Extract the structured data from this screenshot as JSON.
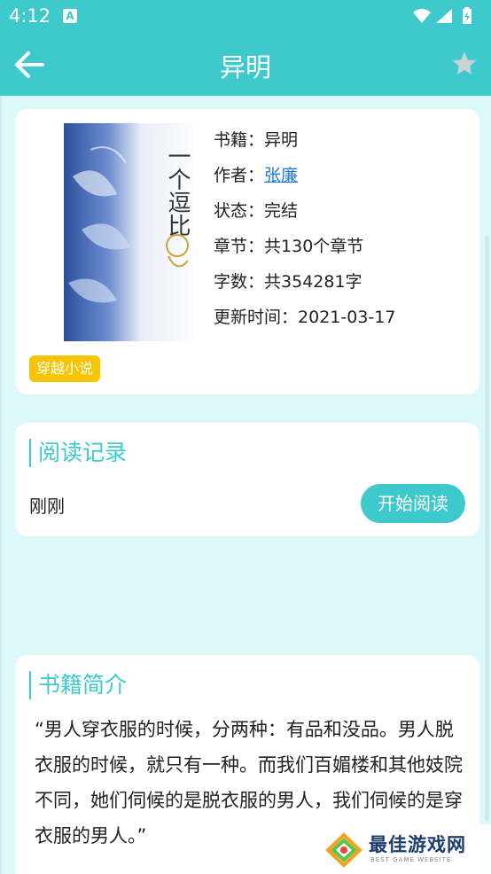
{
  "status_bar": {
    "time": "4:12",
    "notification_letter": "A"
  },
  "app_bar": {
    "title": "异明",
    "back_icon": "arrow-left-icon",
    "favorite_icon": "star-icon"
  },
  "book": {
    "cover_title": "一个逗比",
    "rows": {
      "name": {
        "label": "书籍：",
        "value": "异明"
      },
      "author": {
        "label": "作者：",
        "value": "张廉"
      },
      "status": {
        "label": "状态：",
        "value": "完结"
      },
      "chapters": {
        "label": "章节：",
        "value": "共130个章节"
      },
      "words": {
        "label": "字数：",
        "value": "共354281字"
      },
      "updated": {
        "label": "更新时间：",
        "value": "2021-03-17"
      }
    },
    "genre_tag": "穿越小说"
  },
  "reading_record": {
    "title": "阅读记录",
    "last_read": "刚刚",
    "start_button": "开始阅读"
  },
  "intro": {
    "title": "书籍简介",
    "text": "“男人穿衣服的时候，分两种：有品和没品。男人脱衣服的时候，就只有一种。而我们百媚楼和其他妓院不同，她们伺候的是脱衣服的男人，我们伺候的是穿衣服的男人。”"
  },
  "watermark": {
    "title": "最佳游戏网",
    "subtitle": "BEST GAME WEBSITE"
  },
  "colors": {
    "primary": "#3ec9cc",
    "background": "#ddf8f8",
    "link": "#1e78d8",
    "tag": "#f7c400"
  }
}
